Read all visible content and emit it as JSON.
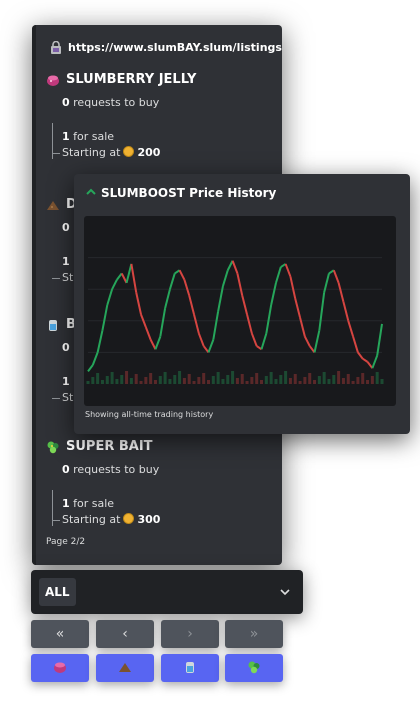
{
  "listing": {
    "url": "https://www.slumBAY.slum/listings",
    "url_icon": "lock-icon",
    "items": [
      {
        "name": "SLUMBERRY JELLY",
        "icon": "jelly-icon",
        "requests_count": "0",
        "requests_label": "requests to buy",
        "for_sale_count": "1",
        "for_sale_label": "for sale",
        "starting_label": "Starting at",
        "price": "200"
      },
      {
        "name": "SUPER BAIT",
        "icon": "bait-icon",
        "requests_count": "0",
        "requests_label": "requests to buy",
        "for_sale_count": "1",
        "for_sale_label": "for sale",
        "starting_label": "Starting at",
        "price": "300"
      }
    ],
    "partial_rows": [
      {
        "initial": "D",
        "icon": "dirt-icon",
        "count_a": "0",
        "count_b": "1",
        "tail_b": "St"
      },
      {
        "initial": "B",
        "icon": "bottle-icon",
        "count_a": "0",
        "count_b": "1",
        "tail_b": "St"
      }
    ],
    "page": "Page 2/2"
  },
  "popup": {
    "title": "SLUMBOOST Price History",
    "title_icon": "trend-up-icon",
    "footer": "Showing all-time trading history",
    "colors": {
      "up": "#26a65b",
      "down": "#d64541",
      "bg": "#18191c"
    }
  },
  "chart_data": {
    "type": "line",
    "title": "SLUMBOOST Price History",
    "xlabel": "",
    "ylabel": "",
    "y_range": [
      0,
      100
    ],
    "series": [
      {
        "values": [
          8,
          12,
          20,
          34,
          50,
          60,
          66,
          70,
          64,
          76,
          58,
          44,
          36,
          28,
          22,
          30,
          48,
          60,
          70,
          72,
          66,
          56,
          44,
          32,
          24,
          20,
          28,
          46,
          62,
          72,
          78,
          70,
          56,
          44,
          32,
          24,
          22,
          32,
          50,
          64,
          74,
          76,
          68,
          54,
          42,
          30,
          24,
          20,
          34,
          58,
          70,
          72,
          64,
          52,
          40,
          30,
          20,
          16,
          14,
          10,
          18,
          38
        ]
      }
    ],
    "moves": [
      "up",
      "up",
      "up",
      "up",
      "up",
      "up",
      "up",
      "up",
      "down",
      "up",
      "down",
      "down",
      "down",
      "down",
      "down",
      "up",
      "up",
      "up",
      "up",
      "up",
      "down",
      "down",
      "down",
      "down",
      "down",
      "down",
      "up",
      "up",
      "up",
      "up",
      "up",
      "down",
      "down",
      "down",
      "down",
      "down",
      "down",
      "up",
      "up",
      "up",
      "up",
      "up",
      "down",
      "down",
      "down",
      "down",
      "down",
      "down",
      "up",
      "up",
      "up",
      "up",
      "down",
      "down",
      "down",
      "down",
      "down",
      "down",
      "down",
      "down",
      "up",
      "up"
    ]
  },
  "select": {
    "value": "ALL",
    "icon": "chevron-down-icon"
  },
  "nav": [
    "«",
    "‹",
    "›",
    "»"
  ],
  "item_buttons": [
    "jelly-icon",
    "dirt-icon",
    "bottle-icon",
    "bait-icon"
  ]
}
